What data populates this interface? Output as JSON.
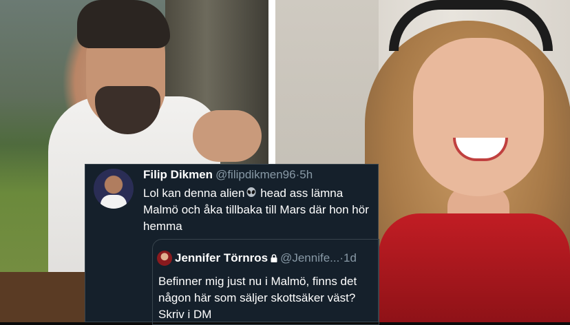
{
  "tweet": {
    "author_name": "Filip Dikmen",
    "author_handle": "@filipdikmen96",
    "separator": "·",
    "time": "5h",
    "text_before_icon": "Lol kan denna alien",
    "text_after_icon": " head ass lämna Malmö och åka tillbaka till Mars där hon hör hemma",
    "icon": "alien-emoji"
  },
  "quoted_tweet": {
    "author_name": "Jennifer Törnros",
    "author_handle": "@Jennife...",
    "separator": "·",
    "time": "1d",
    "lock_icon": "lock-icon",
    "text": "Befinner mig just nu i Malmö, finns det någon här som säljer skottsäker väst? Skriv i DM"
  },
  "colors": {
    "card_background": "#15202b",
    "border": "#38444d",
    "muted_text": "#8899a6",
    "divider": "#ffffff"
  }
}
